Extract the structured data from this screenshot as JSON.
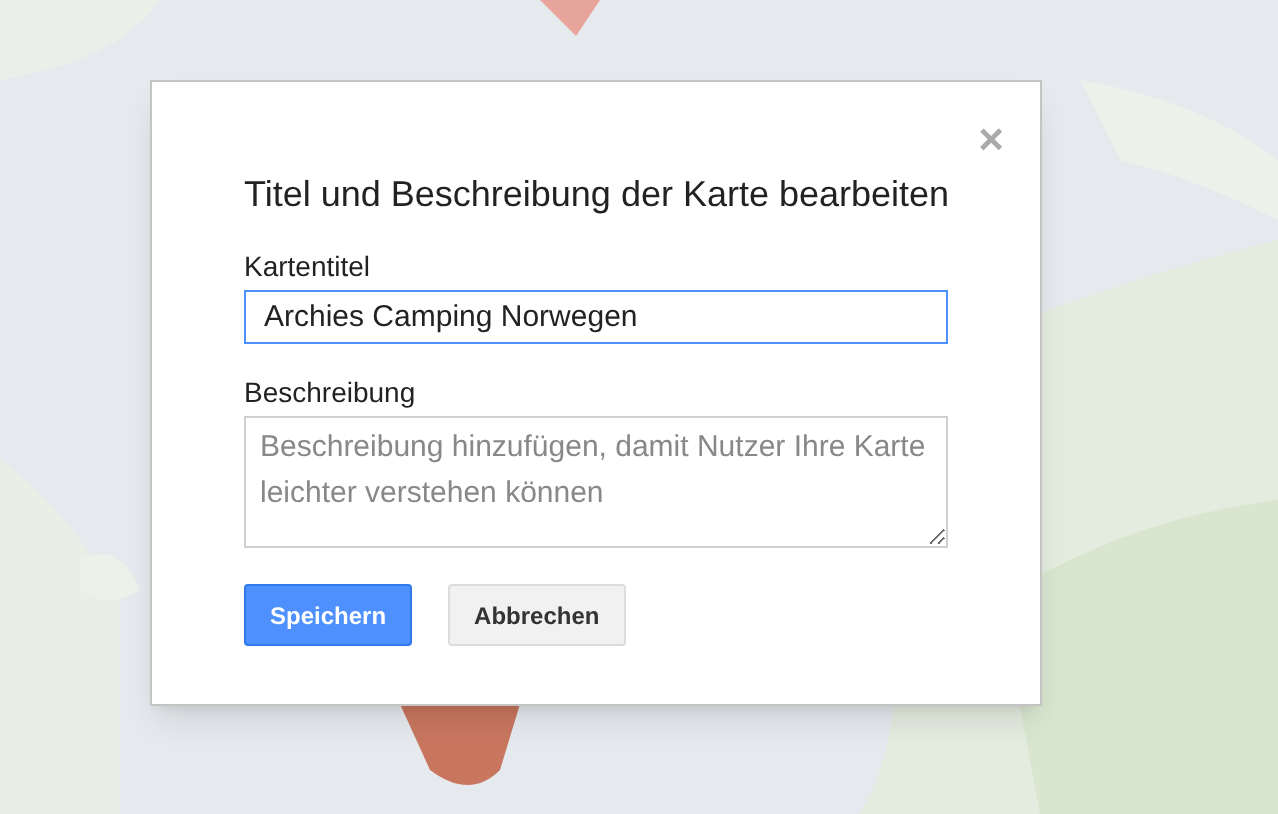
{
  "dialog": {
    "title": "Titel und Beschreibung der Karte bearbeiten",
    "close": "×",
    "fields": [
      {
        "kind": "input",
        "label": "Kartentitel",
        "value": "Archies Camping Norwegen",
        "focused": true
      },
      {
        "kind": "textarea",
        "label": "Beschreibung",
        "placeholder": "Beschreibung hinzufügen, damit Nutzer Ihre Karte leichter verstehen können",
        "focused": false
      }
    ],
    "buttons": [
      {
        "label": "Speichern",
        "kind": "primary"
      },
      {
        "label": "Abbrechen",
        "kind": "secondary"
      }
    ]
  }
}
